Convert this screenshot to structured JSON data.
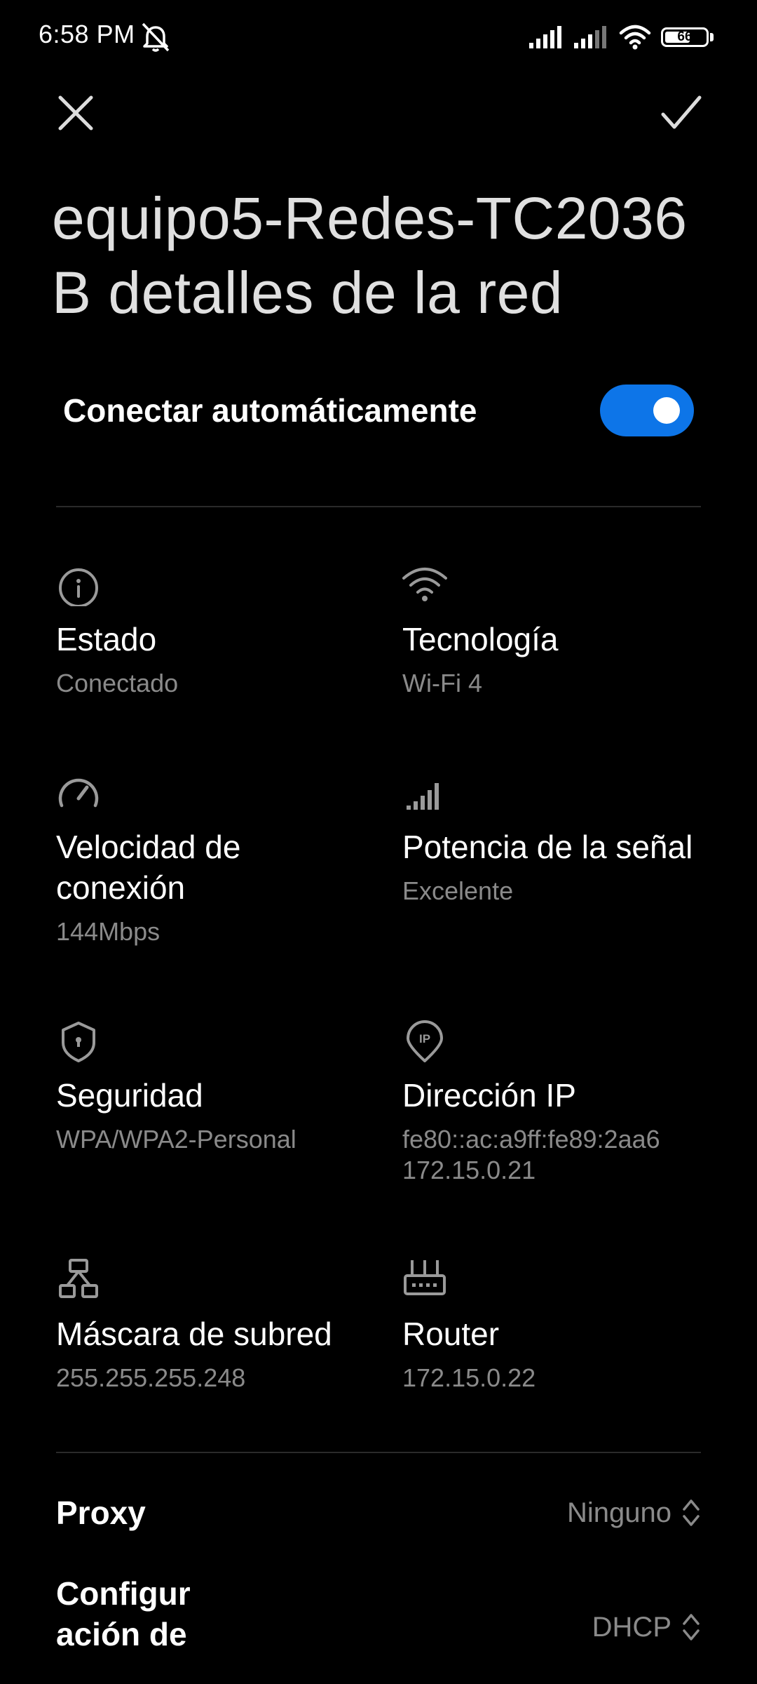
{
  "status_bar": {
    "time": "6:58 PM",
    "battery_level": "66",
    "battery_fraction": 0.66
  },
  "header": {
    "close_icon": "close-icon",
    "confirm_icon": "check-icon",
    "title": "equipo5-Redes-TC2036\nB detalles de la red"
  },
  "auto_connect": {
    "label": "Conectar automáticamente",
    "enabled": true,
    "accent": "#0d75e8"
  },
  "details": [
    {
      "icon": "info-icon",
      "label": "Estado",
      "value": "Conectado"
    },
    {
      "icon": "wifi-icon",
      "label": "Tecnología",
      "value": "Wi-Fi 4"
    },
    {
      "icon": "speedometer-icon",
      "label": "Velocidad de conexión",
      "value": "144Mbps"
    },
    {
      "icon": "signal-strength-icon",
      "label": "Potencia de la señal",
      "value": "Excelente"
    },
    {
      "icon": "shield-icon",
      "label": "Seguridad",
      "value": "WPA/WPA2-Personal"
    },
    {
      "icon": "ip-location-icon",
      "label": "Dirección IP",
      "value": "fe80::ac:a9ff:fe89:2aa6\n172.15.0.21"
    },
    {
      "icon": "subnet-icon",
      "label": "Máscara de subred",
      "value": "255.255.255.248"
    },
    {
      "icon": "router-icon",
      "label": "Router",
      "value": "172.15.0.22"
    }
  ],
  "settings": {
    "proxy": {
      "label": "Proxy",
      "value": "Ninguno"
    },
    "ip_config": {
      "label": "Configur\nación de",
      "value": "DHCP"
    }
  }
}
